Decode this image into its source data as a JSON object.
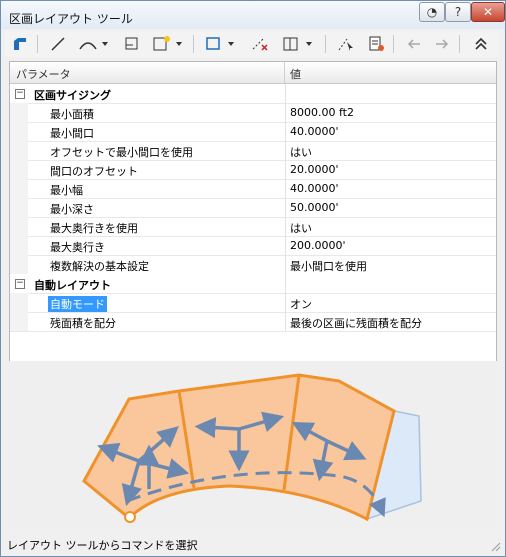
{
  "window": {
    "title": "区画レイアウト ツール"
  },
  "grid": {
    "headers": {
      "param": "パラメータ",
      "value": "値"
    },
    "categories": [
      {
        "label": "区画サイジング",
        "rows": [
          {
            "name": "最小面積",
            "value": "8000.00 ft2"
          },
          {
            "name": "最小間口",
            "value": "40.0000'"
          },
          {
            "name": "オフセットで最小間口を使用",
            "value": "はい"
          },
          {
            "name": "間口のオフセット",
            "value": "20.0000'"
          },
          {
            "name": "最小幅",
            "value": "40.0000'"
          },
          {
            "name": "最小深さ",
            "value": "50.0000'"
          },
          {
            "name": "最大奥行きを使用",
            "value": "はい"
          },
          {
            "name": "最大奥行き",
            "value": "200.0000'"
          },
          {
            "name": "複数解決の基本設定",
            "value": "最小間口を使用"
          }
        ]
      },
      {
        "label": "自動レイアウト",
        "rows": [
          {
            "name": "自動モード",
            "value": "オン",
            "selected": true
          },
          {
            "name": "残面積を配分",
            "value": "最後の区画に残面積を配分"
          }
        ]
      }
    ]
  },
  "status": {
    "text": "レイアウト ツールからコマンドを選択"
  },
  "colors": {
    "accent": "#3399ff",
    "parcel_fill": "#f9c79b",
    "parcel_edge": "#f0922b",
    "arrow": "#6b88b0",
    "remainder": "#dce9f8"
  },
  "icons": [
    "parcel-tool-icon",
    "line-icon",
    "curve-icon",
    "frontage-icon",
    "add-parcel-icon",
    "slide-line-icon",
    "delete-segment-icon",
    "parcel-union-icon",
    "pick-subentity-icon",
    "subentity-editor-icon",
    "undo-icon",
    "redo-icon",
    "collapse-icon"
  ]
}
